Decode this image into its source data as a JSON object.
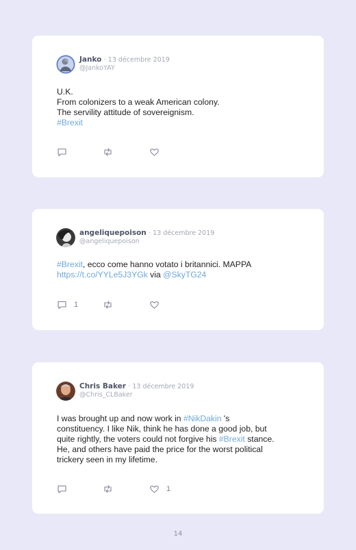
{
  "page_number": "14",
  "tweets": [
    {
      "author": "Janko",
      "date": "· 13 décembre 2019",
      "handle": "@JankoYAY",
      "lines": [
        [
          {
            "t": "U.K."
          }
        ],
        [
          {
            "t": "From colonizers to a weak American colony."
          }
        ],
        [
          {
            "t": "The servility attitude of sovereignism."
          }
        ],
        [
          {
            "t": "#Brexit",
            "link": true
          }
        ]
      ],
      "reply_count": "",
      "retweet_count": "",
      "like_count": ""
    },
    {
      "author": "angeliquepoison",
      "date": "· 13 décembre 2019",
      "handle": "@angeliquepoison",
      "lines": [
        [
          {
            "t": "#Brexit",
            "link": true
          },
          {
            "t": ", ecco come hanno votato i britannici. MAPPA"
          }
        ],
        [
          {
            "t": "https://t.co/YYLe5J3YGk",
            "link": true
          },
          {
            "t": " via "
          },
          {
            "t": "@SkyTG24",
            "link": true
          }
        ]
      ],
      "reply_count": "1",
      "retweet_count": "",
      "like_count": ""
    },
    {
      "author": "Chris Baker",
      "date": "· 13 décembre 2019",
      "handle": "@Chris_CLBaker",
      "lines": [
        [
          {
            "t": "I was brought up and now work in "
          },
          {
            "t": "#NikDakin",
            "link": true
          },
          {
            "t": " 's"
          }
        ],
        [
          {
            "t": "constituency. I like Nik, think he has done a good job, but"
          }
        ],
        [
          {
            "t": "quite rightly, the voters could not forgive his "
          },
          {
            "t": "#Brexit",
            "link": true
          },
          {
            "t": " stance."
          }
        ],
        [
          {
            "t": "He, and others have paid the price for the worst political"
          }
        ],
        [
          {
            "t": "trickery seen in my lifetime."
          }
        ]
      ],
      "reply_count": "",
      "retweet_count": "",
      "like_count": "1"
    }
  ]
}
